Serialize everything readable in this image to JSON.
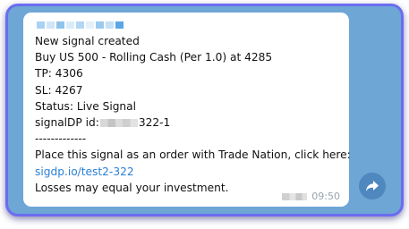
{
  "message": {
    "lines": [
      "New signal created",
      "Buy US 500 - Rolling Cash (Per 1.0) at 4285",
      "TP: 4306",
      "SL: 4267",
      "Status: Live Signal"
    ],
    "signal_id_label": "signalDP id:",
    "signal_id_suffix": "322-1",
    "separator": "-------------",
    "cta": "Place this signal as an order with Trade Nation, click here:",
    "link_text": "sigdp.io/test2-322",
    "disclaimer": "Losses may equal your investment.",
    "time": "09:50"
  },
  "colors": {
    "frame_border": "#6b6cf0",
    "chat_background": "#6ea6d6",
    "link": "#2a7fd6",
    "share_button": "#4f87bf"
  },
  "icons": {
    "share": "share-forward-icon"
  }
}
